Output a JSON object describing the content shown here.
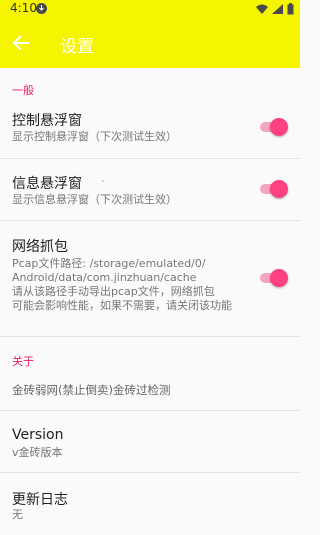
{
  "status_bar": {
    "time": "4:10"
  },
  "app_bar": {
    "title": "设置"
  },
  "sections": {
    "general": "一般",
    "about": "关于"
  },
  "prefs": {
    "floating_window": {
      "title": "控制悬浮窗",
      "summary": "显示控制悬浮窗（下次测试生效）",
      "enabled": true
    },
    "info_window": {
      "title": "信息悬浮窗",
      "summary": "显示信息悬浮窗（下次测试生效）",
      "enabled": true
    },
    "packet_capture": {
      "title": "网络抓包",
      "summary_lines": [
        "Pcap文件路径: /storage/emulated/0/",
        "Android/data/com.jinzhuan/cache",
        "请从该路径手动导出pcap文件，网络抓包",
        "可能会影响性能，如果不需要，请关闭该功能"
      ],
      "enabled": true
    }
  },
  "about": {
    "description": "金砖弱网(禁止倒卖)金砖过检测",
    "version_title": "Version",
    "version_value": "v金砖版本",
    "changelog_title": "更新日志",
    "changelog_value": "无"
  },
  "colors": {
    "bar": "#f5f500",
    "accent": "#e91e63",
    "switch_on": "#ff4081"
  }
}
